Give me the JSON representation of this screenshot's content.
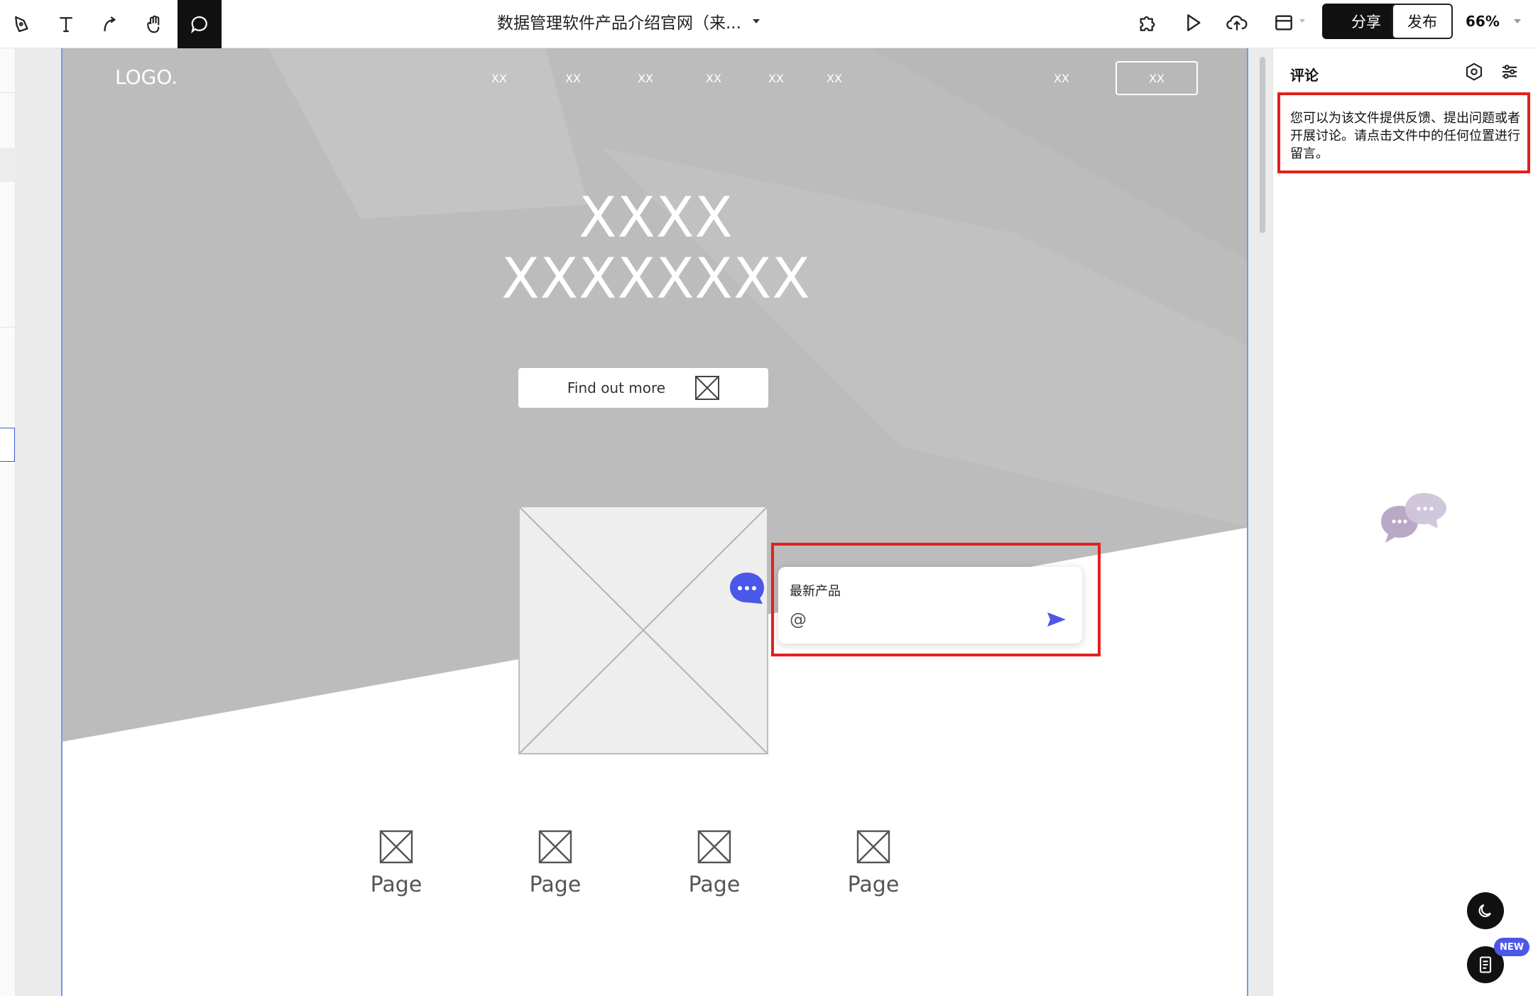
{
  "toolbar": {
    "tools": [
      "pen-tool",
      "text-tool",
      "connector-tool",
      "hand-tool",
      "comment-tool"
    ],
    "active_tool": "comment-tool",
    "doc_title": "数据管理软件产品介绍官网（来...",
    "share_label": "分享",
    "publish_label": "发布",
    "zoom": "66%"
  },
  "artboard": {
    "logo": "LOGO.",
    "nav": [
      "XX",
      "XX",
      "XX",
      "XX",
      "XX",
      "XX"
    ],
    "nav_right": "XX",
    "nav_button": "XX",
    "hero_line1": "XXXX",
    "hero_line2": "XXXXXXXX",
    "cta_label": "Find out more",
    "pages": [
      "Page",
      "Page",
      "Page",
      "Page"
    ]
  },
  "comment_composer": {
    "text": "最新产品",
    "mention": "@"
  },
  "comments_panel": {
    "title": "评论",
    "hint": "您可以为该文件提供反馈、提出问题或者开展讨论。请点击文件中的任何位置进行留言。",
    "new_badge": "NEW"
  },
  "colors": {
    "accent": "#4b57e8",
    "highlight": "#e3201b",
    "hero_gray": "#bdbdbd",
    "artboard_border": "#6a9cf0"
  }
}
